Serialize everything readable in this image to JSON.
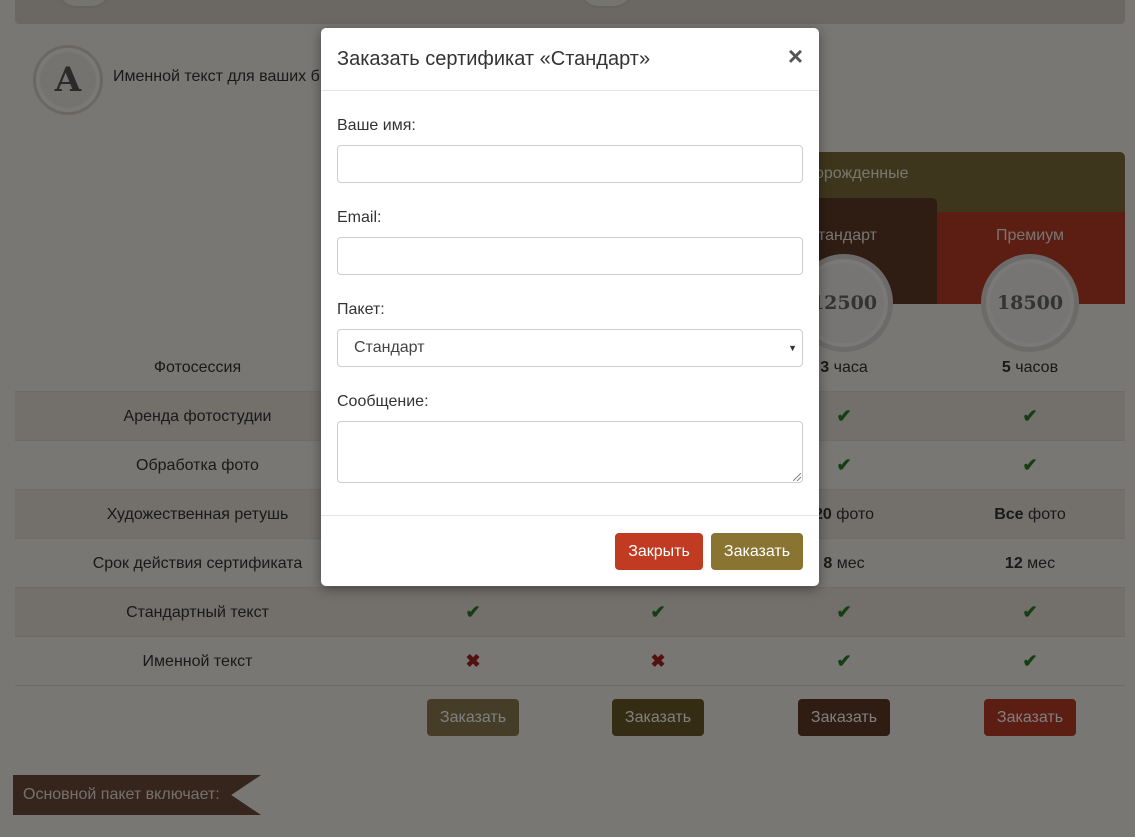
{
  "background": {
    "intro_text": "Именной текст для ваших б",
    "avatar_letter": "A",
    "header_group": "орожденные",
    "plan_standard": "тандарт",
    "plan_premium": "Премиум",
    "price_standard": "12500",
    "price_premium": "18500",
    "rows": [
      {
        "label": "Фотосессия",
        "c3_num": "3",
        "c3_unit": " часа",
        "c4_num": "5",
        "c4_unit": " часов"
      },
      {
        "label": "Аренда фотостудии"
      },
      {
        "label": "Обработка фото"
      },
      {
        "label": "Художественная ретушь",
        "c3_num": "20",
        "c3_unit": " фото",
        "c4_num": "Все",
        "c4_unit": " фото"
      },
      {
        "label": "Срок действия сертификата",
        "c3_num": "8",
        "c3_unit": " мес",
        "c4_num": "12",
        "c4_unit": " мес"
      },
      {
        "label": "Стандартный текст"
      },
      {
        "label": "Именной текст"
      }
    ],
    "check_glyph": "✔",
    "cross_glyph": "✖",
    "order_button_label": "Заказать",
    "ribbon_text": "Основной пакет включает:",
    "colors": {
      "olive": "#7c6d38",
      "brown": "#5f3a26",
      "red": "#b93a24",
      "khaki": "#8c7a50"
    }
  },
  "modal": {
    "title": "Заказать сертификат «Стандарт»",
    "close_glyph": "×",
    "name_label": "Ваше имя:",
    "name_value": "",
    "email_label": "Email:",
    "email_value": "",
    "package_label": "Пакет:",
    "package_selected": "Стандарт",
    "message_label": "Сообщение:",
    "message_value": "",
    "close_button": "Закрыть",
    "submit_button": "Заказать",
    "colors": {
      "close_btn": "#c13a22",
      "submit_btn": "#8a7432"
    }
  }
}
